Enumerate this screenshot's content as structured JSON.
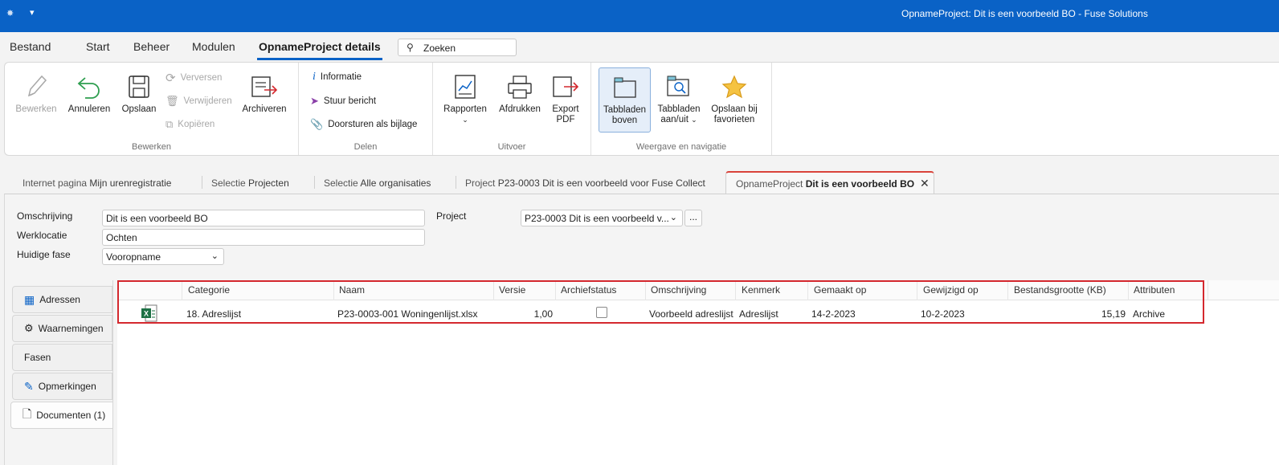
{
  "window": {
    "title": "OpnameProject: Dit is een voorbeeld BO - Fuse Solutions"
  },
  "menu": {
    "tabs": [
      "Bestand",
      "Start",
      "Beheer",
      "Modulen",
      "OpnameProject details"
    ],
    "active_tab": "OpnameProject details",
    "search_placeholder": "Zoeken"
  },
  "ribbon": {
    "groups": {
      "bewerken": {
        "label": "Bewerken",
        "bewerken": "Bewerken",
        "annuleren": "Annuleren",
        "opslaan": "Opslaan",
        "verversen": "Verversen",
        "verwijderen": "Verwijderen",
        "kopieren": "Kopiëren",
        "archiveren": "Archiveren"
      },
      "delen": {
        "label": "Delen",
        "informatie": "Informatie",
        "stuur_bericht": "Stuur bericht",
        "doorsturen": "Doorsturen als bijlage"
      },
      "uitvoer": {
        "label": "Uitvoer",
        "rapporten": "Rapporten",
        "afdrukken": "Afdrukken",
        "export_l1": "Export",
        "export_l2": "PDF"
      },
      "weergave": {
        "label": "Weergave en navigatie",
        "tabbladen_boven_l1": "Tabbladen",
        "tabbladen_boven_l2": "boven",
        "tabbladen_aanuit_l1": "Tabbladen",
        "tabbladen_aanuit_l2": "aan/uit",
        "opslaan_fav_l1": "Opslaan bij",
        "opslaan_fav_l2": "favorieten"
      }
    }
  },
  "doc_tabs": [
    {
      "prefix": "Internet pagina",
      "name": "Mijn urenregistratie"
    },
    {
      "prefix": "Selectie",
      "name": "Projecten"
    },
    {
      "prefix": "Selectie",
      "name": "Alle organisaties"
    },
    {
      "prefix": "Project",
      "name": "P23-0003 Dit is een voorbeeld voor Fuse Collect"
    },
    {
      "prefix": "OpnameProject",
      "name": "Dit is een voorbeeld BO",
      "active": true
    }
  ],
  "form": {
    "omschrijving_label": "Omschrijving",
    "omschrijving_value": "Dit is een voorbeeld BO",
    "werklocatie_label": "Werklocatie",
    "werklocatie_value": "Ochten",
    "fase_label": "Huidige fase",
    "fase_value": "Vooropname",
    "project_label": "Project",
    "project_value": "P23-0003 Dit is een voorbeeld v...",
    "dots": "..."
  },
  "side_tabs": [
    "Adressen",
    "Waarnemingen",
    "Fasen",
    "Opmerkingen",
    "Documenten (1)"
  ],
  "grid": {
    "columns": [
      "Categorie",
      "Naam",
      "Versie",
      "Archiefstatus",
      "Omschrijving",
      "Kenmerk",
      "Gemaakt op",
      "Gewijzigd op",
      "Bestandsgrootte (KB)",
      "Attributen"
    ],
    "rows": [
      {
        "categorie": "18. Adreslijst",
        "naam": "P23-0003-001 Woningenlijst.xlsx",
        "versie": "1,00",
        "archiefstatus": false,
        "omschrijving": "Voorbeeld adreslijst",
        "kenmerk": "Adreslijst",
        "gemaakt_op": "14-2-2023",
        "gewijzigd_op": "10-2-2023",
        "bestandsgrootte": "15,19",
        "attributen": "Archive"
      }
    ]
  }
}
